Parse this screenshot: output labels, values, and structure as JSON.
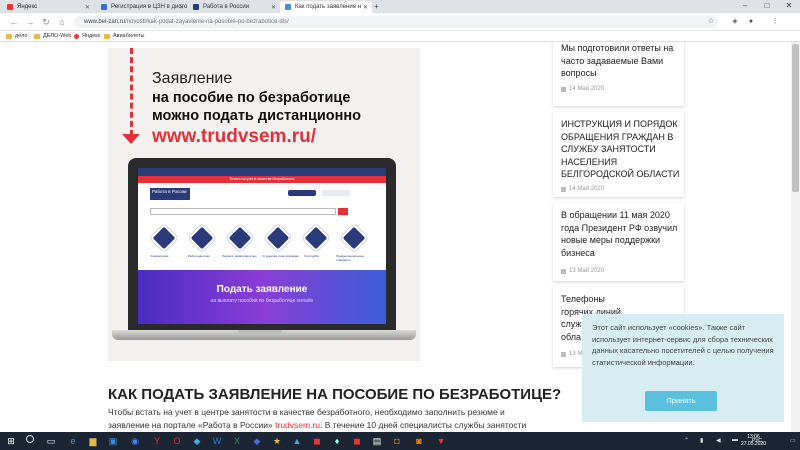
{
  "browser": {
    "tabs": [
      {
        "label": "Яндекс",
        "fav_color": "#e33"
      },
      {
        "label": "Регистрация в ЦЗН в дисто",
        "fav_color": "#3b6fd6"
      },
      {
        "label": "Работа в России",
        "fav_color": "#2b3a7a"
      },
      {
        "label": "Как подать заявление н",
        "fav_color": "#4a8bd6"
      }
    ],
    "new_tab": "+",
    "address": {
      "host": "www.bel-zan.ru",
      "path": "/novosti/kak-podat-zayavlenie-na-posobie-po-bezrabotice-dis/"
    },
    "bookmarks": [
      "дело",
      "ДЕЛО-Web",
      "Яндекс",
      "Авиабилеты"
    ]
  },
  "hero": {
    "line1": "Заявление",
    "line2": "на пособие по безработице",
    "line3": "можно подать дистанционно",
    "url": "www.trudvsem.ru/",
    "screen": {
      "red_bar": "Встать на учет в качестве безработного",
      "logo": "Работа в России",
      "banner_title": "Подать заявление",
      "banner_sub": "на выплату пособия по безработице онлайн",
      "tiles": [
        "Соискателям",
        "Работодателям",
        "Людям с инвалидностью",
        "Студентам и выпускникам",
        "Госслужба",
        "Профессиональные стандарты"
      ]
    }
  },
  "article": {
    "title": "КАК ПОДАТЬ ЗАЯВЛЕНИЕ НА ПОСОБИЕ ПО БЕЗРАБОТИЦЕ?",
    "para_a": "Чтобы встать на учет в центре занятости в качестве безработного, необходимо заполнить резюме и заявление на портале «Работа в России» ",
    "para_link": "trudvsem.ru",
    "para_b": ". В течение 10 дней специалисты службы занятости будут подбирать"
  },
  "sidebar": [
    {
      "title": "Мы подготовили ответы на часто задаваемые Вами вопросы",
      "date": "14 Май 2020"
    },
    {
      "title": "ИНСТРУКЦИЯ И ПОРЯДОК ОБРАЩЕНИЯ ГРАЖДАН В СЛУЖБУ ЗАНЯТОСТИ НАСЕЛЕНИЯ БЕЛГОРОДСКОЙ ОБЛАСТИ",
      "date": "14 Май 2020"
    },
    {
      "title": "В обращении 11 мая 2020 года Президент РФ озвучил новые меры поддержки бизнеса",
      "date": "13 Май 2020"
    },
    {
      "title": "Телефоны горячих линий служ насел обла",
      "date": "13 М"
    }
  ],
  "cookie": {
    "text": "Этот сайт использует «cookies». Также сайт использует интернет-сервис для сбора технических данных касательно посетителей с целью получения статистической информации.",
    "button": "Принять"
  },
  "taskbar": {
    "time": "13:06",
    "date": "27.05.2020",
    "lang": "РУС"
  }
}
